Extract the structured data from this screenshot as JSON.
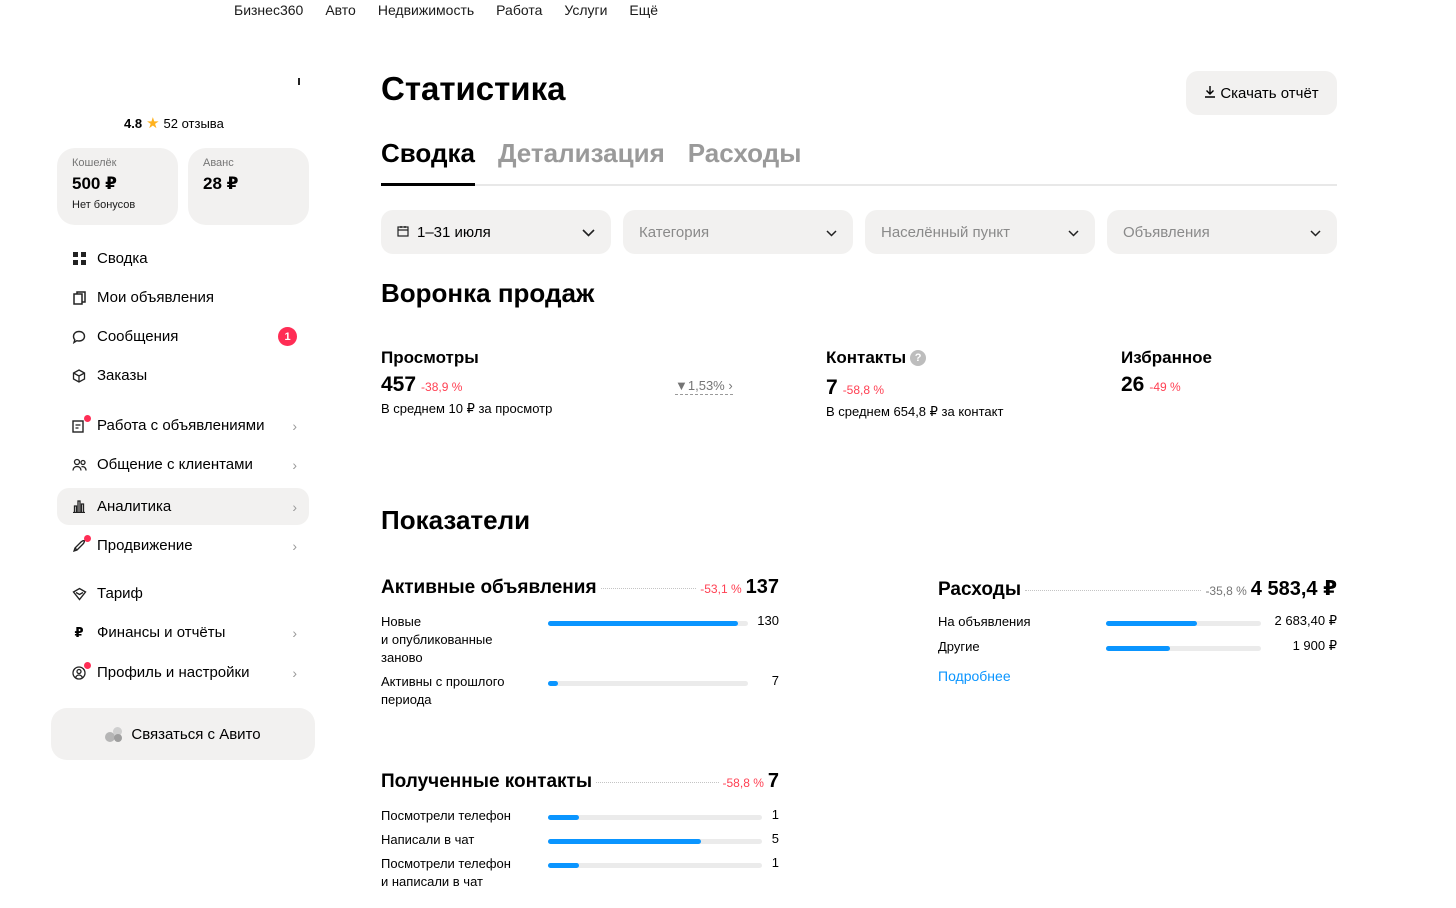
{
  "topnav": [
    "Бизнес360",
    "Авто",
    "Недвижимость",
    "Работа",
    "Услуги",
    "Ещё"
  ],
  "sidebar": {
    "rating": "4.8",
    "reviews": "52 отзыва",
    "wallet": {
      "label": "Кошелёк",
      "amount": "500 ₽",
      "note": "Нет бонусов"
    },
    "advance": {
      "label": "Аванс",
      "amount": "28 ₽"
    },
    "items": [
      {
        "label": "Сводка",
        "icon": "grid-icon"
      },
      {
        "label": "Мои объявления",
        "icon": "copy-icon"
      },
      {
        "label": "Сообщения",
        "icon": "chat-icon",
        "badge": "1"
      },
      {
        "label": "Заказы",
        "icon": "box-icon"
      },
      {
        "label": "Работа с объявлениями",
        "icon": "listing-tools-icon"
      },
      {
        "label": "Общение с клиентами",
        "icon": "people-icon"
      },
      {
        "label": "Аналитика",
        "icon": "bar-chart-icon"
      },
      {
        "label": "Продвижение",
        "icon": "rocket-icon"
      },
      {
        "label": "Тариф",
        "icon": "tariff-icon"
      },
      {
        "label": "Финансы и отчёты",
        "icon": "ruble-icon"
      },
      {
        "label": "Профиль и настройки",
        "icon": "profile-icon"
      }
    ],
    "contact_button": "Связаться с Авито"
  },
  "main": {
    "title": "Статистика",
    "download_label": "Скачать отчёт",
    "tabs": [
      "Сводка",
      "Детализация",
      "Расходы"
    ],
    "filters": {
      "date": "1–31 июля",
      "category": "Категория",
      "locality": "Населённый пункт",
      "listings": "Объявления"
    },
    "funnel": {
      "title": "Воронка продаж",
      "views": {
        "title": "Просмотры",
        "value": "457",
        "delta": "-38,9 %",
        "sub": "В среднем 10 ₽ за просмотр"
      },
      "conversion": "1,53%",
      "contacts": {
        "title": "Контакты",
        "value": "7",
        "delta": "-58,8 %",
        "sub": "В среднем 654,8 ₽ за контакт"
      },
      "favorites": {
        "title": "Избранное",
        "value": "26",
        "delta": "-49 %"
      }
    },
    "indicators_title": "Показатели",
    "active_listings": {
      "title": "Активные объявления",
      "delta": "-53,1 %",
      "value": "137",
      "rows": [
        {
          "label_lines": [
            "Новые",
            "и опубликованные",
            "заново"
          ],
          "value": "130",
          "fraction": 0.95
        },
        {
          "label_lines": [
            "Активны с прошлого",
            "периода"
          ],
          "value": "7",
          "fraction": 0.05
        }
      ]
    },
    "expenses": {
      "title": "Расходы",
      "delta": "-35,8 %",
      "value": "4 583,4 ₽",
      "rows": [
        {
          "label": "На объявления",
          "value": "2 683,40 ₽",
          "fraction": 0.585
        },
        {
          "label": "Другие",
          "value": "1 900 ₽",
          "fraction": 0.415
        }
      ],
      "more_link": "Подробнее"
    },
    "received_contacts": {
      "title": "Полученные контакты",
      "delta": "-58,8 %",
      "value": "7",
      "rows": [
        {
          "label_lines": [
            "Посмотрели телефон"
          ],
          "value": "1",
          "fraction": 0.143
        },
        {
          "label_lines": [
            "Написали в чат"
          ],
          "value": "5",
          "fraction": 0.714
        },
        {
          "label_lines": [
            "Посмотрели телефон",
            "и написали в чат"
          ],
          "value": "1",
          "fraction": 0.143
        }
      ]
    }
  },
  "colors": {
    "accent": "#0a95ff",
    "negative": "#ff4053",
    "badge": "#ff2d55",
    "star": "#ffb21e",
    "panel": "#f2f1f0"
  }
}
